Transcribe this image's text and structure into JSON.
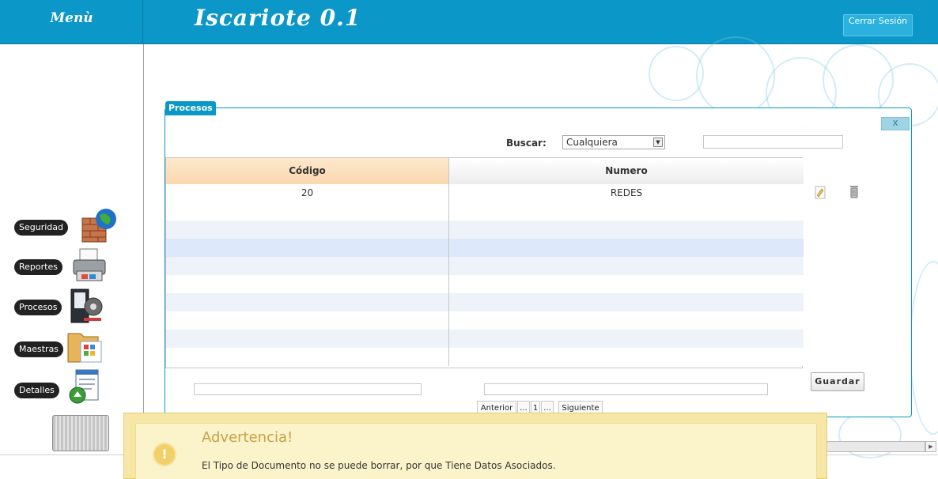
{
  "header": {
    "menu_label": "Menù",
    "app_title": "Iscariote 0.1",
    "logout_label": "Cerrar Sesión"
  },
  "sidebar": {
    "items": [
      {
        "label": "Seguridad",
        "icon": "globe-wall-icon"
      },
      {
        "label": "Reportes",
        "icon": "printer-icon"
      },
      {
        "label": "Procesos",
        "icon": "gear-window-icon"
      },
      {
        "label": "Maestras",
        "icon": "folder-icon"
      },
      {
        "label": "Detalles",
        "icon": "document-upload-icon"
      }
    ],
    "bottom_icon": "trash-bin-icon"
  },
  "panel": {
    "title": "Procesos",
    "close_label": "X",
    "search": {
      "label": "Buscar:",
      "select_value": "Cualquiera",
      "input_value": ""
    },
    "table": {
      "columns": [
        "Código",
        "Numero"
      ],
      "rows": [
        {
          "codigo": "20",
          "numero": "REDES"
        }
      ]
    },
    "save_label": "Guardar",
    "pager": {
      "prev": "Anterior",
      "ellipsis_left": "...",
      "page": "1",
      "ellipsis_right": "...",
      "next": "Siguiente"
    }
  },
  "alert": {
    "title": "Advertencia!",
    "message": "El Tipo de Documento no se puede borrar, por que Tiene Datos Asociados.",
    "icon_glyph": "!"
  },
  "colors": {
    "header": "#0b97c8",
    "column_header_highlight": "#fbd8ae",
    "alert_background": "#f6e7a6"
  }
}
